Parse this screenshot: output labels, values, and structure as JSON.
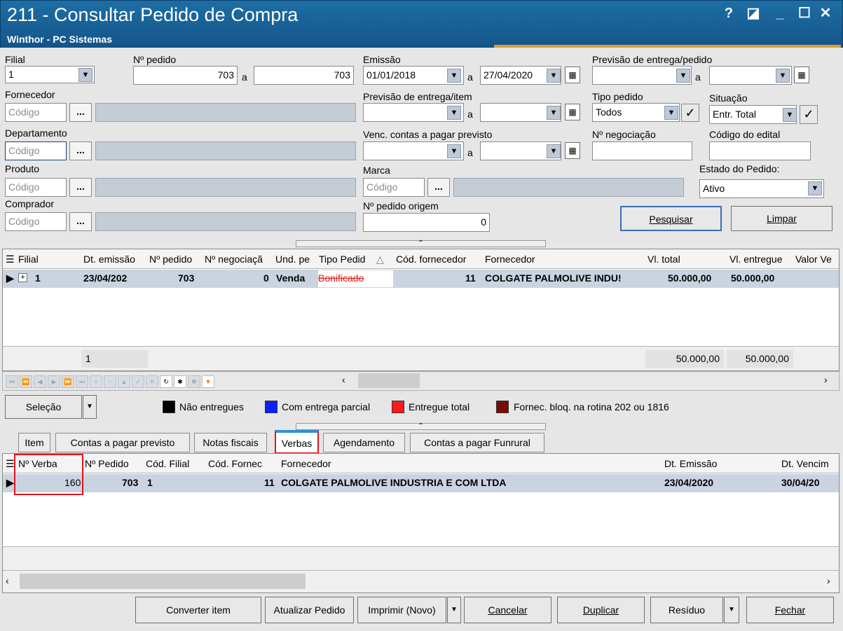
{
  "window": {
    "title": "211 - Consultar Pedido de Compra",
    "subtitle": "Winthor - PC Sistemas",
    "help": "?",
    "restore": "◪",
    "minimize": "_",
    "maximize": "☐",
    "close": "✕"
  },
  "form": {
    "filial_label": "Filial",
    "filial_value": "1",
    "pedido_label": "Nº pedido",
    "pedido_from": "703",
    "pedido_a": "a",
    "pedido_to": "703",
    "emissao_label": "Emissão",
    "emissao_from": "01/01/2018",
    "emissao_a": "a",
    "emissao_to": "27/04/2020",
    "prev_entrega_pedido_label": "Previsão de entrega/pedido",
    "prev_entrega_pedido_a": "a",
    "fornecedor_label": "Fornecedor",
    "codigo_placeholder": "Código",
    "prev_entrega_item_label": "Previsão de entrega/item",
    "prev_entrega_item_a": "a",
    "tipo_pedido_label": "Tipo pedido",
    "tipo_pedido_value": "Todos",
    "situacao_label": "Situação",
    "situacao_value": "Entr. Total",
    "departamento_label": "Departamento",
    "venc_label": "Venc. contas a  pagar previsto",
    "venc_a": "a",
    "negociacao_label": "Nº negociação",
    "edital_label": "Código do edital",
    "produto_label": "Produto",
    "marca_label": "Marca",
    "estado_label": "Estado do Pedido:",
    "estado_value": "Ativo",
    "comprador_label": "Comprador",
    "pedido_origem_label": "Nº pedido origem",
    "pedido_origem_value": "0",
    "pesquisar": "Pesquisar",
    "limpar": "Limpar",
    "dots": "..."
  },
  "top_grid": {
    "headers": [
      "Filial",
      "Dt. emissão",
      "Nº pedido",
      "Nº negociaçã",
      "Und. pe",
      "Tipo Pedid",
      "Cód. fornecedor",
      "Fornecedor",
      "Vl. total",
      "Vl. entregue",
      "Valor Ve"
    ],
    "row": {
      "filial": "1",
      "dt_emissao": "23/04/202",
      "pedido": "703",
      "negociacao": "0",
      "und": "Venda",
      "tipo": "Bonificado",
      "cod_fornecedor": "11",
      "fornecedor": "COLGATE PALMOLIVE INDU!",
      "vl_total": "50.000,00",
      "vl_entregue": "50.000,00"
    },
    "footer": {
      "count": "1",
      "total": "50.000,00",
      "entregue": "50.000,00"
    }
  },
  "selecao": {
    "label": "Seleção"
  },
  "legend": [
    {
      "label": "Não entregues",
      "color": "#000000"
    },
    {
      "label": "Com entrega parcial",
      "color": "#0a22ff"
    },
    {
      "label": "Entregue total",
      "color": "#ff1a1a"
    },
    {
      "label": "Fornec. bloq. na rotina 202 ou 1816",
      "color": "#7a0a0a"
    }
  ],
  "tabs": [
    "Item",
    "Contas a pagar previsto",
    "Notas fiscais",
    "Verbas",
    "Agendamento",
    "Contas a pagar Funrural"
  ],
  "bottom_grid": {
    "headers": [
      "Nº Verba",
      "Nº Pedido",
      "Cód. Filial",
      "Cód. Fornec",
      "Fornecedor",
      "Dt. Emissão",
      "Dt. Vencim"
    ],
    "row": {
      "verba": "160",
      "pedido": "703",
      "filial": "1",
      "fornec": "11",
      "fornecedor": "COLGATE PALMOLIVE INDUSTRIA  E COM LTDA",
      "dt_emissao": "23/04/2020",
      "dt_venc": "30/04/20"
    }
  },
  "buttons": {
    "converter": "Converter item",
    "atualizar": "Atualizar Pedido",
    "imprimir": "Imprimir (Novo)",
    "cancelar": "Cancelar",
    "duplicar": "Duplicar",
    "residuo": "Resíduo",
    "fechar": "Fechar"
  },
  "colors": {
    "titlebar": "#1765a0",
    "highlight_box": "#e0141c",
    "selected_row": "#c9d4e0",
    "tipo_strike": "#e02020"
  }
}
